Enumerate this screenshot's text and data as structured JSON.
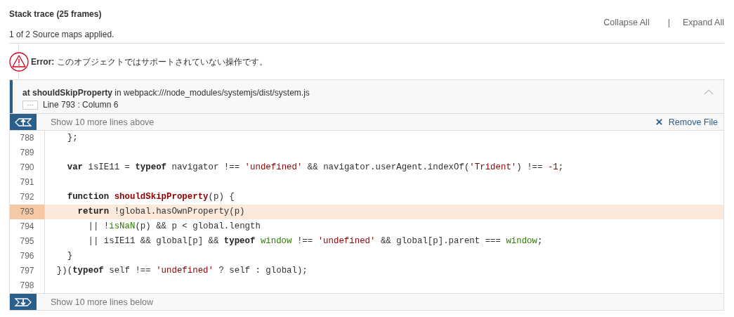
{
  "header": {
    "title": "Stack trace (25 frames)",
    "source_maps": "1 of 2 Source maps applied.",
    "actions": [
      "Collapse All",
      "Expand All"
    ],
    "separator": "|"
  },
  "error": {
    "label": "Error:",
    "message": "このオブジェクトではサポートされていない操作です。"
  },
  "frame": {
    "expanded": true,
    "prefix": "at",
    "function": "shouldSkipProperty",
    "in": "in",
    "file": "webpack:///node_modules/systemjs/dist/system.js",
    "ellipsis": "···",
    "location": "Line 793 : Column 6",
    "show_above": "Show 10 more lines above",
    "remove": "Remove File",
    "show_below": "Show 10 more lines below",
    "lines": [
      {
        "number": "788",
        "highlighted": false,
        "tokens": [
          {
            "kind": "plain",
            "text": "    };"
          }
        ]
      },
      {
        "number": "789",
        "highlighted": false
      },
      {
        "number": "790",
        "highlighted": false,
        "tokens": [
          {
            "kind": "keyword",
            "text": "    var"
          },
          {
            "kind": "plain",
            "text": " isIE11 = "
          },
          {
            "kind": "keyword",
            "text": "typeof"
          },
          {
            "kind": "plain",
            "text": " navigator !== "
          },
          {
            "kind": "string",
            "text": "'undefined'"
          },
          {
            "kind": "plain",
            "text": " && navigator.userAgent.indexOf("
          },
          {
            "kind": "string",
            "text": "'Trident'"
          },
          {
            "kind": "plain",
            "text": ") !== "
          },
          {
            "kind": "number",
            "text": "-1"
          },
          {
            "kind": "plain",
            "text": ";"
          }
        ]
      },
      {
        "number": "791",
        "highlighted": false
      },
      {
        "number": "792",
        "highlighted": false,
        "tokens": [
          {
            "kind": "keyword",
            "text": "    function "
          },
          {
            "kind": "function",
            "text": "shouldSkipProperty"
          },
          {
            "kind": "plain",
            "text": "(p) {"
          }
        ]
      },
      {
        "number": "793",
        "highlighted": true,
        "tokens": [
          {
            "kind": "keyword",
            "text": "      return"
          },
          {
            "kind": "plain",
            "text": " !global.hasOwnProperty(p)"
          }
        ]
      },
      {
        "number": "794",
        "highlighted": false,
        "tokens": [
          {
            "kind": "plain",
            "text": "        || !"
          },
          {
            "kind": "builtin",
            "text": "isNaN"
          },
          {
            "kind": "plain",
            "text": "(p) && p < global.length"
          }
        ]
      },
      {
        "number": "795",
        "highlighted": false,
        "tokens": [
          {
            "kind": "plain",
            "text": "        || isIE11 && global[p] && "
          },
          {
            "kind": "keyword",
            "text": "typeof "
          },
          {
            "kind": "builtin",
            "text": "window"
          },
          {
            "kind": "plain",
            "text": " !== "
          },
          {
            "kind": "string",
            "text": "'undefined'"
          },
          {
            "kind": "plain",
            "text": " && global[p].parent === "
          },
          {
            "kind": "builtin",
            "text": "window"
          },
          {
            "kind": "plain",
            "text": ";"
          }
        ]
      },
      {
        "number": "796",
        "highlighted": false,
        "tokens": [
          {
            "kind": "plain",
            "text": "    }"
          }
        ]
      },
      {
        "number": "797",
        "highlighted": false,
        "tokens": [
          {
            "kind": "plain",
            "text": "  })("
          },
          {
            "kind": "keyword",
            "text": "typeof"
          },
          {
            "kind": "plain",
            "text": " self !== "
          },
          {
            "kind": "string",
            "text": "'undefined'"
          },
          {
            "kind": "plain",
            "text": " ? self : global);"
          }
        ]
      },
      {
        "number": "798",
        "highlighted": false
      }
    ]
  }
}
